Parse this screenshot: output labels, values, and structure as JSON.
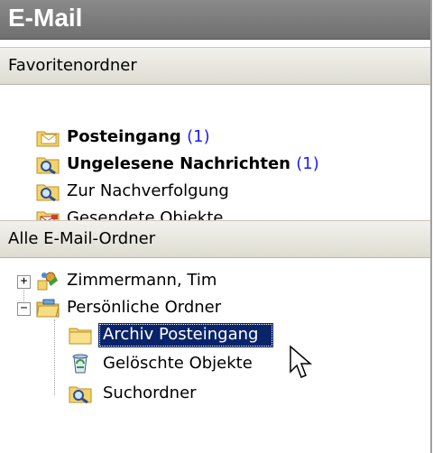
{
  "header": {
    "title": "E-Mail"
  },
  "favorites": {
    "header": "Favoritenordner",
    "items": [
      {
        "label": "Posteingang",
        "count": "(1)",
        "bold": true,
        "icon": "inbox-icon"
      },
      {
        "label": "Ungelesene Nachrichten",
        "count": "(1)",
        "bold": true,
        "icon": "search-folder-icon"
      },
      {
        "label": "Zur Nachverfolgung",
        "count": "",
        "bold": false,
        "icon": "search-folder-icon"
      },
      {
        "label": "Gesendete Objekte",
        "count": "",
        "bold": false,
        "icon": "sent-items-icon"
      }
    ]
  },
  "all_folders": {
    "header": "Alle E-Mail-Ordner",
    "tree": [
      {
        "label": "Zimmermann, Tim",
        "expander": "+",
        "icon": "mailbox-icon"
      },
      {
        "label": "Persönliche Ordner",
        "expander": "−",
        "icon": "personal-folders-icon"
      },
      {
        "label": "Archiv Posteingang",
        "selected": true,
        "icon": "folder-icon"
      },
      {
        "label": "Gelöschte Objekte",
        "icon": "deleted-items-icon"
      },
      {
        "label": "Suchordner",
        "icon": "search-folder-icon"
      }
    ]
  },
  "colors": {
    "selection": "#0a246a",
    "count": "#1a1aff"
  }
}
